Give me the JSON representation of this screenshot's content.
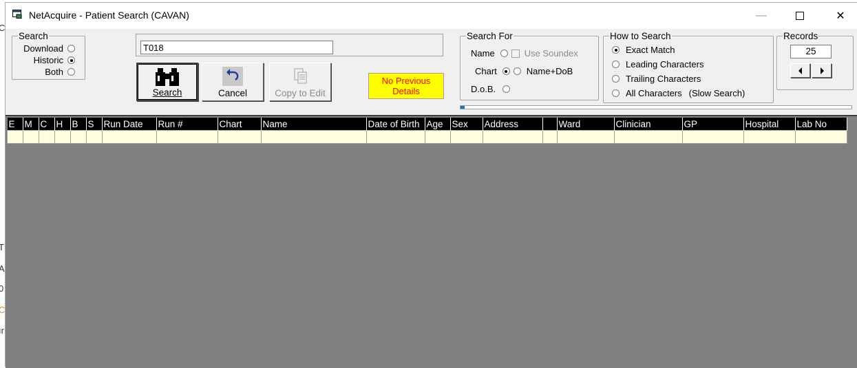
{
  "window": {
    "title": "NetAcquire - Patient Search (CAVAN)"
  },
  "bg_peek": [
    "C",
    "Th",
    "Ac",
    "0",
    "C",
    "ır"
  ],
  "search_group": {
    "legend": "Search",
    "options": [
      {
        "label": "Download",
        "checked": false
      },
      {
        "label": "Historic",
        "checked": true
      },
      {
        "label": "Both",
        "checked": false
      }
    ]
  },
  "search_input": {
    "value": "T018"
  },
  "toolbar": {
    "search_label": "Search",
    "cancel_label": "Cancel",
    "copy_label": "Copy to Edit"
  },
  "status_label": "No Previous Details",
  "search_for": {
    "legend": "Search For",
    "name_label": "Name",
    "soundex_label": "Use Soundex",
    "chart_label": "Chart",
    "name_dob_label": "Name+DoB",
    "dob_label": "D.o.B.",
    "selected": "chart"
  },
  "how_to_search": {
    "legend": "How to Search",
    "options": [
      {
        "label": "Exact Match",
        "checked": true
      },
      {
        "label": "Leading Characters",
        "checked": false
      },
      {
        "label": "Trailing Characters",
        "checked": false
      },
      {
        "label": "All Characters",
        "checked": false
      }
    ],
    "slow_note": "(Slow Search)"
  },
  "records": {
    "legend": "Records",
    "value": "25"
  },
  "progress": 0.01,
  "grid": {
    "columns": [
      "E",
      "M",
      "C",
      "H",
      "B",
      "S",
      "Run Date",
      "Run #",
      "Chart",
      "Name",
      "Date of Birth",
      "Age",
      "Sex",
      "Address",
      "",
      "Ward",
      "Clinician",
      "GP",
      "Hospital",
      "Lab No"
    ]
  }
}
